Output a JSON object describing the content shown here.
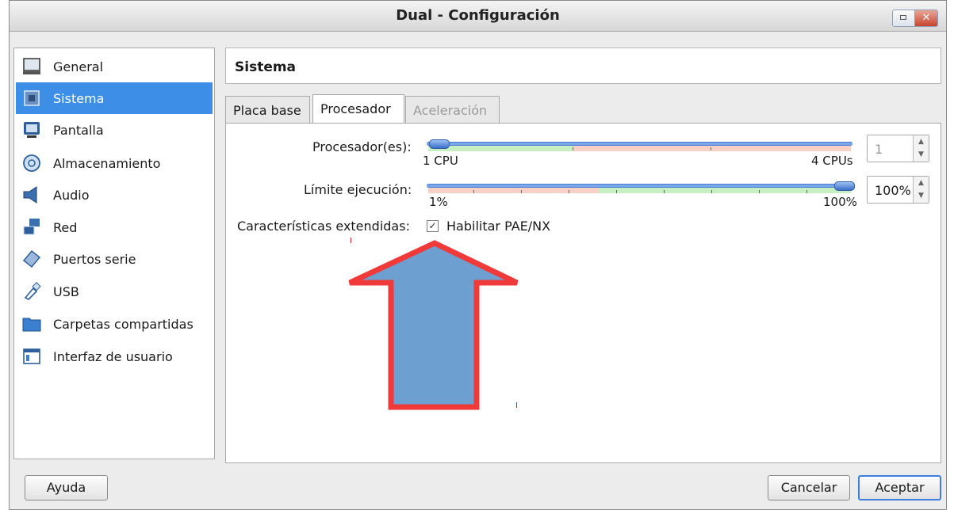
{
  "window": {
    "title": "Dual - Configuración",
    "close_glyph": "✕"
  },
  "sidebar": {
    "items": [
      {
        "label": "General",
        "icon": "monitor-icon"
      },
      {
        "label": "Sistema",
        "icon": "chip-icon",
        "selected": true
      },
      {
        "label": "Pantalla",
        "icon": "display-icon"
      },
      {
        "label": "Almacenamiento",
        "icon": "storage-icon"
      },
      {
        "label": "Audio",
        "icon": "speaker-icon"
      },
      {
        "label": "Red",
        "icon": "network-icon"
      },
      {
        "label": "Puertos serie",
        "icon": "serial-port-icon"
      },
      {
        "label": "USB",
        "icon": "usb-icon"
      },
      {
        "label": "Carpetas compartidas",
        "icon": "folder-icon"
      },
      {
        "label": "Interfaz de usuario",
        "icon": "window-icon"
      }
    ]
  },
  "main": {
    "header": "Sistema",
    "tabs": [
      {
        "label": "Placa base",
        "state": "inactive"
      },
      {
        "label": "Procesador",
        "state": "active"
      },
      {
        "label": "Aceleración",
        "state": "disabled"
      }
    ],
    "processor": {
      "label": "Procesador(es):",
      "min_label": "1 CPU",
      "max_label": "4 CPUs",
      "value": "1",
      "slider_fraction": 0.0
    },
    "exec_limit": {
      "label": "Límite ejecución:",
      "min_label": "1%",
      "max_label": "100%",
      "value": "100%",
      "slider_fraction": 1.0
    },
    "extended": {
      "label": "Características extendidas:",
      "checkbox_label": "Habilitar PAE/NX",
      "checked": true,
      "check_glyph": "✓"
    }
  },
  "buttons": {
    "help": "Ayuda",
    "cancel": "Cancelar",
    "accept": "Aceptar"
  },
  "spin_glyphs": {
    "up": "▲",
    "down": "▼"
  },
  "colors": {
    "selection": "#3d8ee6",
    "arrow_fill": "#6d9fd0",
    "arrow_stroke": "#f03a3a",
    "green_zone": "#c6f0c2",
    "red_zone": "#f8d0c6"
  }
}
